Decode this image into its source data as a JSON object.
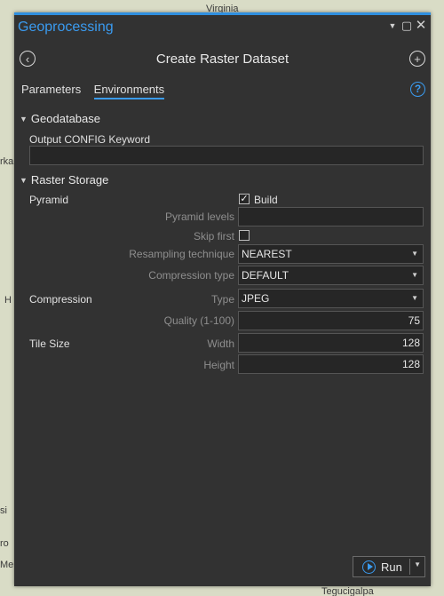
{
  "map": {
    "labels": [
      "Virginia",
      "Tegucigalpa",
      "H",
      "si",
      "ro",
      "Me",
      "rka"
    ]
  },
  "panel": {
    "title": "Geoprocessing",
    "tool_title": "Create Raster Dataset",
    "tabs": [
      "Parameters",
      "Environments"
    ],
    "active_tab": "Environments",
    "icons": {
      "back": "back-arrow-icon",
      "add": "plus-icon",
      "help": "help-icon",
      "window": [
        "dropdown-arrow-icon",
        "restore-icon",
        "close-icon"
      ]
    },
    "help_glyph": "?",
    "geodatabase": {
      "title": "Geodatabase",
      "config_label": "Output CONFIG Keyword",
      "config_value": ""
    },
    "raster_storage": {
      "title": "Raster Storage",
      "pyramid_label": "Pyramid",
      "build_label": "Build",
      "build_checked": true,
      "pyramid_levels_label": "Pyramid levels",
      "pyramid_levels_value": "",
      "skip_first_label": "Skip first",
      "skip_first_checked": false,
      "resampling_label": "Resampling technique",
      "resampling_value": "NEAREST",
      "compression_type_label": "Compression type",
      "compression_type_value": "DEFAULT",
      "compression_label": "Compression",
      "type_label": "Type",
      "type_value": "JPEG",
      "quality_label": "Quality (1-100)",
      "quality_value": "75",
      "tile_size_label": "Tile Size",
      "width_label": "Width",
      "width_value": "128",
      "height_label": "Height",
      "height_value": "128"
    },
    "run_label": "Run"
  }
}
